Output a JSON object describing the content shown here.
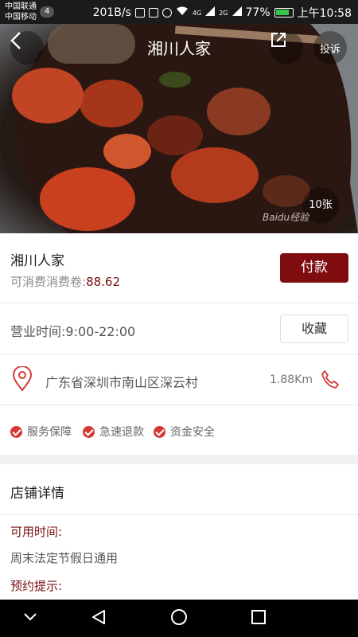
{
  "status_bar": {
    "carrier1": "中国联通",
    "carrier2": "中国移动",
    "badge": "4",
    "speed": "201B/s",
    "signal1": "4G",
    "signal2": "2G",
    "battery_pct": "77%",
    "time": "上午10:58"
  },
  "header": {
    "title": "湘川人家",
    "report_label": "投诉",
    "photo_count": "10张",
    "watermark": "Baidu经验"
  },
  "shop": {
    "name": "湘川人家",
    "voucher_label": "可消费消费卷:",
    "voucher_amount": "88.62",
    "pay_label": "付款"
  },
  "hours": {
    "text": "营业时间:9:00-22:00",
    "favorite_label": "收藏"
  },
  "location": {
    "address": "广东省深圳市南山区深云村",
    "distance": "1.88Km"
  },
  "features": [
    "服务保障",
    "急速退款",
    "资金安全"
  ],
  "details": {
    "title": "店铺详情",
    "available_label": "可用时间:",
    "available_value": "周末法定节假日通用",
    "booking_label": "预约提示:"
  },
  "colors": {
    "brand": "#7f0d10",
    "check": "#d43a36",
    "battery": "#38c24a"
  }
}
